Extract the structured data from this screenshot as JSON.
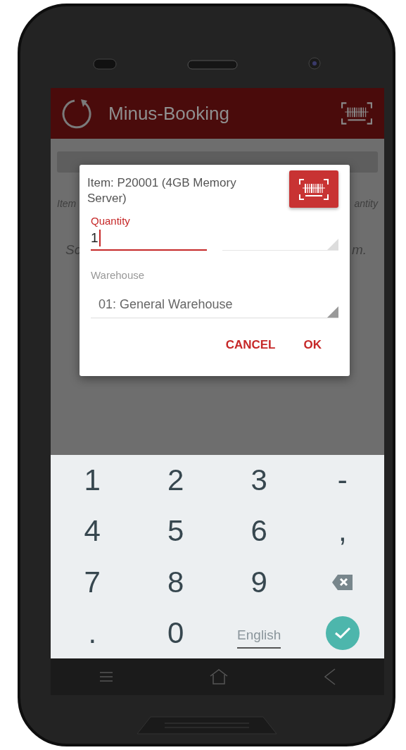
{
  "app_bar": {
    "title": "Minus-Booking"
  },
  "background": {
    "column_labels": [
      "Item",
      "antity"
    ],
    "hint_parts": [
      "Sc",
      "m."
    ]
  },
  "dialog": {
    "title": "Item: P20001 (4GB Memory Server)",
    "quantity": {
      "label": "Quantity",
      "value": "1",
      "focused": true
    },
    "warehouse": {
      "label": "Warehouse",
      "value": "01: General Warehouse",
      "focused": false
    },
    "buttons": [
      "CANCEL",
      "OK"
    ]
  },
  "keyboard": {
    "keys": [
      {
        "kind": "char",
        "label": "1"
      },
      {
        "kind": "char",
        "label": "2"
      },
      {
        "kind": "char",
        "label": "3"
      },
      {
        "kind": "char",
        "label": "-"
      },
      {
        "kind": "char",
        "label": "4"
      },
      {
        "kind": "char",
        "label": "5"
      },
      {
        "kind": "char",
        "label": "6"
      },
      {
        "kind": "char",
        "label": ","
      },
      {
        "kind": "char",
        "label": "7"
      },
      {
        "kind": "char",
        "label": "8"
      },
      {
        "kind": "char",
        "label": "9"
      },
      {
        "kind": "backspace"
      },
      {
        "kind": "char",
        "label": "."
      },
      {
        "kind": "char",
        "label": "0"
      },
      {
        "kind": "language",
        "label": "English"
      },
      {
        "kind": "done"
      }
    ]
  }
}
